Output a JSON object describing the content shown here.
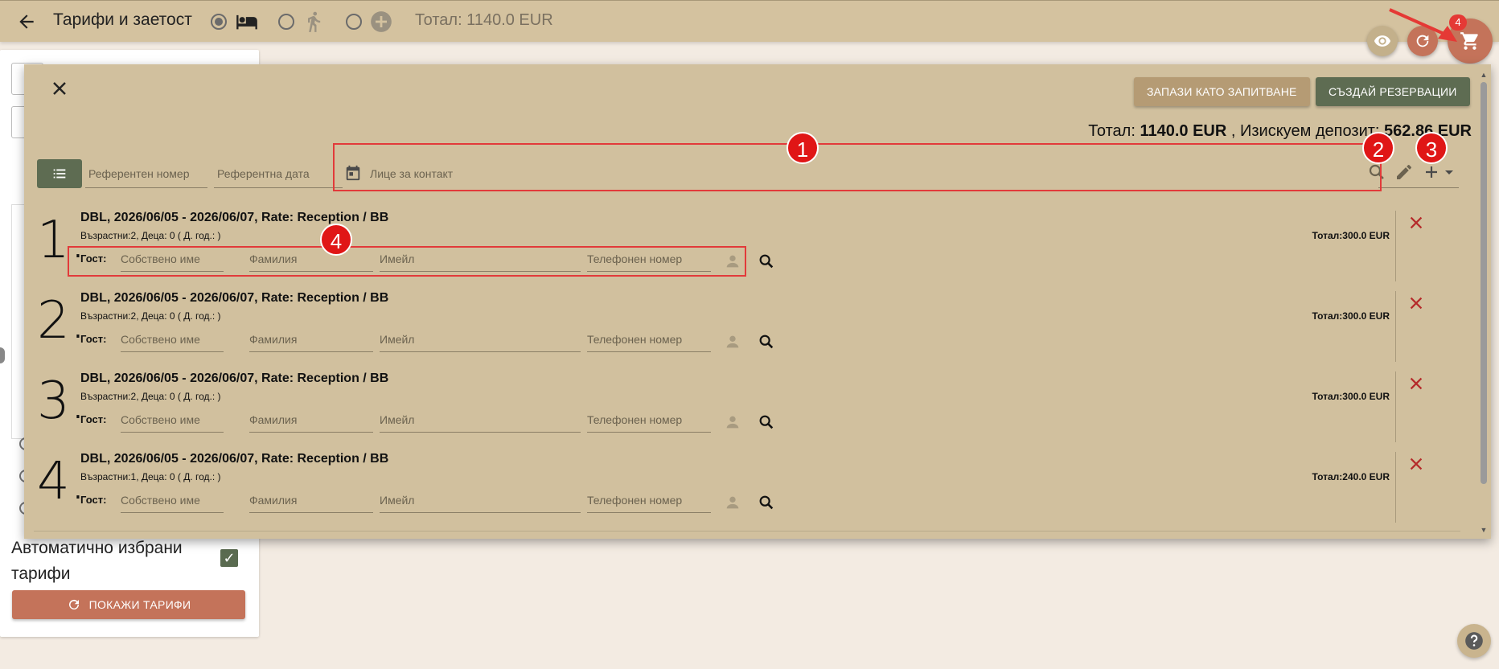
{
  "header": {
    "title": "Тарифи и заетост",
    "total": "Тотал: 1140.0 EUR",
    "mode_icons": [
      "bed-icon",
      "walk-icon",
      "add-circle-icon"
    ]
  },
  "cart": {
    "badge": "4"
  },
  "left_panel": {
    "auto_rates_label": "Автоматично избрани тарифи",
    "show_rates_button": "ПОКАЖИ ТАРИФИ"
  },
  "dialog": {
    "save_as_inquiry": "ЗАПАЗИ КАТО ЗАПИТВАНЕ",
    "create_reservation": "СЪЗДАЙ РЕЗЕРВАЦИИ",
    "totals_prefix": "Тотал:",
    "totals_value": "1140.0 EUR",
    "deposit_prefix": ", Изискуем депозит:",
    "deposit_value": "562.86 EUR",
    "ref_number_placeholder": "Референтен номер",
    "ref_date_placeholder": "Референтна дата",
    "contact_placeholder": "Лице за контакт"
  },
  "markers": [
    "1",
    "2",
    "3",
    "4"
  ],
  "guest_labels": {
    "guest": "Гост:",
    "first_name": "Собствено име",
    "last_name": "Фамилия",
    "email": "Имейл",
    "phone": "Телефонен номер"
  },
  "rows": [
    {
      "num": "1.",
      "head": "DBL, 2026/06/05 - 2026/06/07, Rate: Reception / BB",
      "sub": "Възрастни:2, Деца: 0 ( Д. год.: )",
      "total": "Тотал:300.0 EUR"
    },
    {
      "num": "2.",
      "head": "DBL, 2026/06/05 - 2026/06/07, Rate: Reception / BB",
      "sub": "Възрастни:2, Деца: 0 ( Д. год.: )",
      "total": "Тотал:300.0 EUR"
    },
    {
      "num": "3.",
      "head": "DBL, 2026/06/05 - 2026/06/07, Rate: Reception / BB",
      "sub": "Възрастни:2, Деца: 0 ( Д. год.: )",
      "total": "Тотал:300.0 EUR"
    },
    {
      "num": "4.",
      "head": "DBL, 2026/06/05 - 2026/06/07, Rate: Reception / BB",
      "sub": "Възрастни:1, Деца: 0 ( Д. год.: )",
      "total": "Тотал:240.0 EUR"
    }
  ],
  "colors": {
    "toolbar": "#d4c29f",
    "dialog": "#d1c09e",
    "accent_green": "#5e6c52",
    "accent_brown": "#b59b74",
    "accent_terracotta": "#c4735a",
    "annotation_red": "#e01616"
  }
}
